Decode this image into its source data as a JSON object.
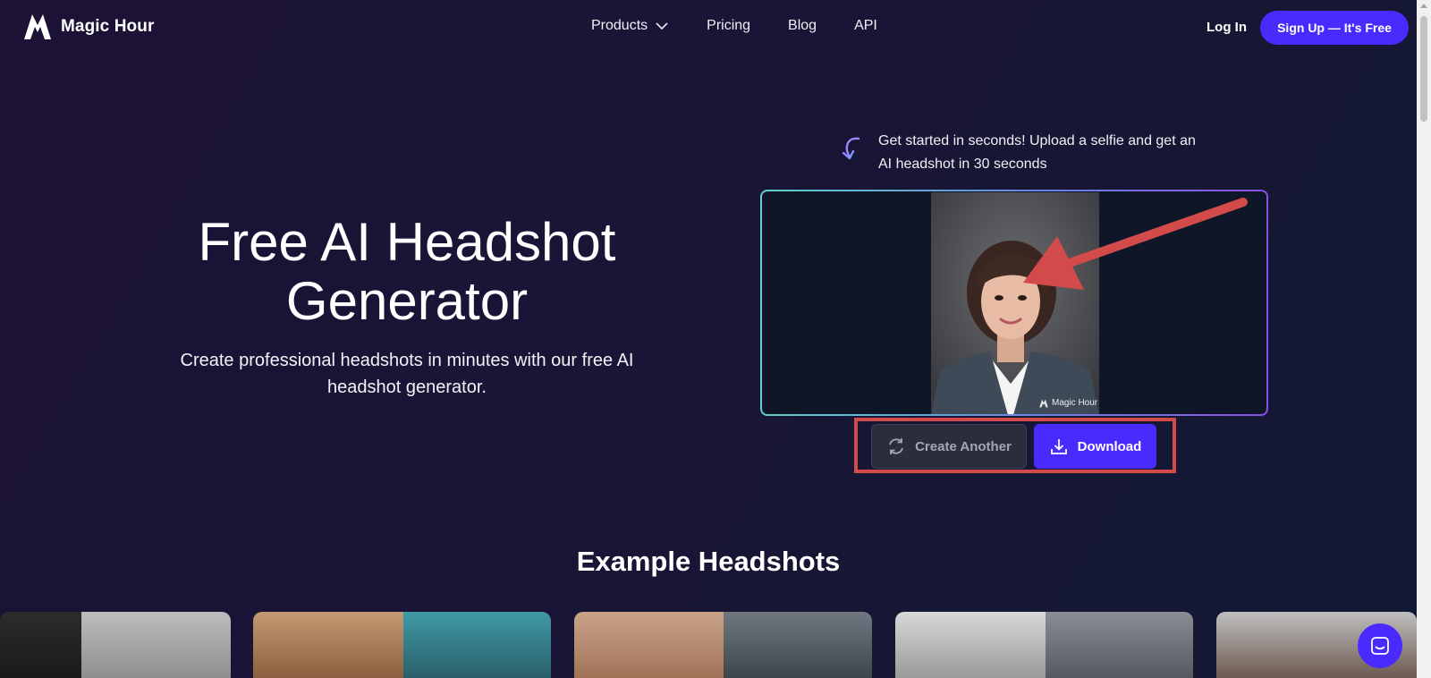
{
  "header": {
    "brand": "Magic Hour",
    "nav": [
      {
        "label": "Products",
        "has_dropdown": true
      },
      {
        "label": "Pricing"
      },
      {
        "label": "Blog"
      },
      {
        "label": "API"
      }
    ],
    "login_label": "Log In",
    "signup_label": "Sign Up — It's Free"
  },
  "hero": {
    "title_line1": "Free AI Headshot",
    "title_line2": "Generator",
    "subtitle": "Create professional headshots in minutes with our free AI headshot generator."
  },
  "preview": {
    "caption": "Get started in seconds! Upload a selfie and get an AI headshot in 30 seconds",
    "watermark": "Magic Hour"
  },
  "actions": {
    "create_another_label": "Create Another",
    "download_label": "Download"
  },
  "examples": {
    "title": "Example Headshots"
  },
  "colors": {
    "accent": "#4a2bff",
    "annotation_red": "#d24a4a",
    "frame_teal": "#5fd1c9",
    "frame_purple": "#8b4fe6"
  },
  "icons": [
    "brand-logo-icon",
    "chevron-down-icon",
    "curved-arrow-icon",
    "refresh-icon",
    "download-icon",
    "chat-icon"
  ]
}
